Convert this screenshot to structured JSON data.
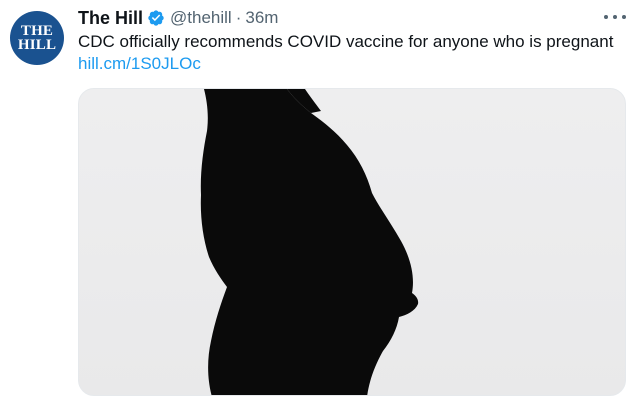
{
  "tweet": {
    "avatar_text_line1": "THE",
    "avatar_text_line2": "HILL",
    "display_name": "The Hill",
    "handle": "@thehill",
    "separator": "·",
    "timestamp": "36m",
    "text": "CDC officially recommends COVID vaccine for anyone who is pregnant",
    "link": "hill.cm/1S0JLOc",
    "verified": true
  },
  "icons": {
    "verified": "verified-badge-icon",
    "more": "more-options-icon"
  },
  "colors": {
    "avatar_bg": "#1a5290",
    "link": "#1d9bf0",
    "verified": "#1d9bf0",
    "secondary_text": "#536471"
  }
}
